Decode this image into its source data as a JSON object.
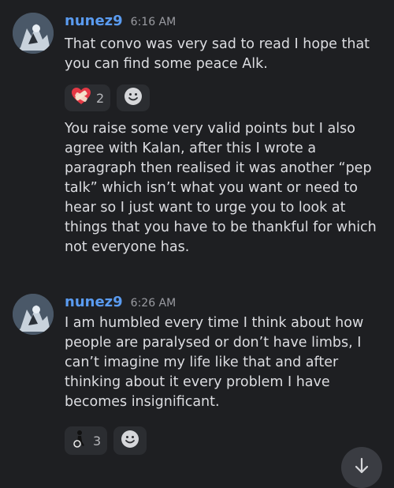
{
  "messages": [
    {
      "username": "nunez9",
      "time": "6:16 AM",
      "text1": "That convo was very sad to read I hope that\nyou can find some peace Alk.",
      "reaction": {
        "count": "2",
        "emoji_icon": "heart-with-bandage-icon"
      },
      "text2": "You raise some very valid points but I also\nagree with Kalan, after this I wrote a\nparagraph then realised it was another “pep\ntalk” which isn’t what you want or need to\nhear so I just want to urge you to look at\nthings that you have to be thankful for which\nnot everyone has."
    },
    {
      "username": "nunez9",
      "time": "6:26 AM",
      "text1": "I am humbled every time I think about how\npeople are paralysed or don’t have limbs, I\ncan’t imagine my life like that and after\nthinking about it every problem I have\nbecomes insignificant.",
      "reaction": {
        "count": "3",
        "emoji_icon": "person-in-wheelchair-icon"
      }
    }
  ],
  "colors": {
    "background": "#1e1f22",
    "username": "#5a9bf0",
    "reaction_bg": "#2b2d31"
  }
}
